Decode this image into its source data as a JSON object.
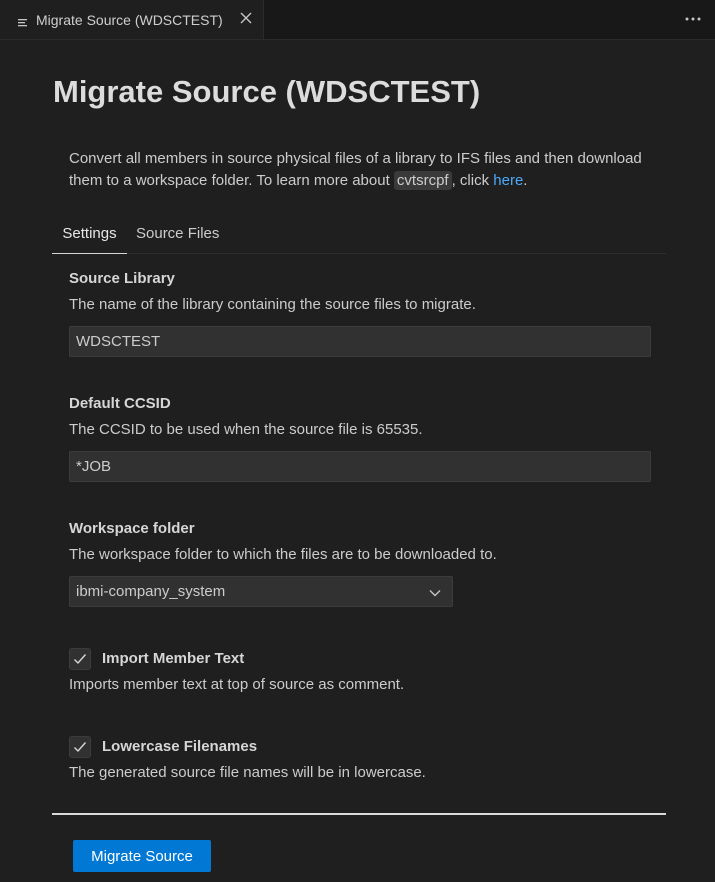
{
  "tab": {
    "title": "Migrate Source (WDSCTEST)",
    "icon": "file-lines-icon",
    "close_icon": "close-icon"
  },
  "toolbar": {
    "more_icon": "more-actions-icon"
  },
  "page": {
    "title": "Migrate Source (WDSCTEST)",
    "intro_before": "Convert all members in source physical files of a library to IFS files and then download them to a workspace folder. To learn more about ",
    "intro_code": "cvtsrcpf",
    "intro_middle": ", click ",
    "intro_link": "here",
    "intro_end": "."
  },
  "panel_tabs": [
    {
      "label": "Settings",
      "active": true
    },
    {
      "label": "Source Files",
      "active": false
    }
  ],
  "fields": {
    "source_library": {
      "label": "Source Library",
      "description": "The name of the library containing the source files to migrate.",
      "value": "WDSCTEST"
    },
    "default_ccsid": {
      "label": "Default CCSID",
      "description": "The CCSID to be used when the source file is 65535.",
      "value": "*JOB"
    },
    "workspace_folder": {
      "label": "Workspace folder",
      "description": "The workspace folder to which the files are to be downloaded to.",
      "selected": "ibmi-company_system"
    },
    "import_member_text": {
      "label": "Import Member Text",
      "description": "Imports member text at top of source as comment.",
      "checked": true
    },
    "lowercase_filenames": {
      "label": "Lowercase Filenames",
      "description": "The generated source file names will be in lowercase.",
      "checked": true
    }
  },
  "actions": {
    "migrate_label": "Migrate Source"
  },
  "colors": {
    "background": "#1f1f1f",
    "accent": "#0078d4",
    "link": "#4daafc"
  }
}
